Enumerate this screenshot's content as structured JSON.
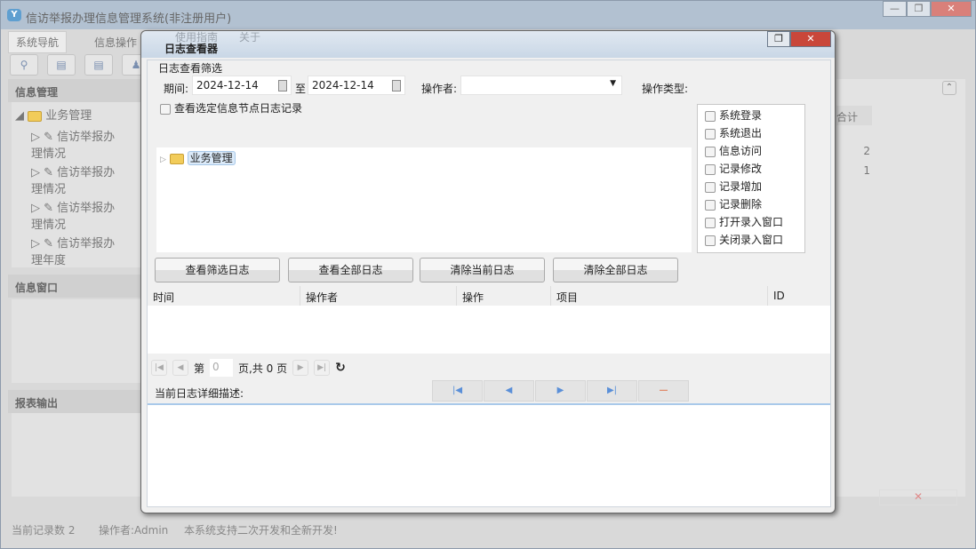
{
  "app": {
    "title": "信访举报办理信息管理系统(非注册用户)",
    "logo_text": "Y"
  },
  "window_controls": {
    "minimize": "—",
    "restore": "❐",
    "close": "✕"
  },
  "tabs": [
    "系统导航",
    "信息操作",
    "使用指南",
    "关于"
  ],
  "toolbar_icons": [
    "search-icon",
    "list-icon",
    "document-icon",
    "user-icon"
  ],
  "sidebar": {
    "sections": [
      "信息管理",
      "信息窗口",
      "报表输出"
    ],
    "tree_root": "业务管理",
    "tree_items": [
      "信访举报办理情况",
      "信访举报办理情况",
      "信访举报办理情况",
      "信访举报办理年度"
    ]
  },
  "right_table": {
    "header": "合计",
    "values": [
      "2",
      "1"
    ]
  },
  "status": {
    "records": "当前记录数 2",
    "operator": "操作者:Admin",
    "message": "本系统支持二次开发和全新开发!"
  },
  "dialog": {
    "title": "日志查看器",
    "filter_title": "日志查看筛选",
    "period_label": "期间:",
    "date_from": "2024-12-14",
    "to_label": "至",
    "date_to": "2024-12-14",
    "operator_label": "操作者:",
    "operator_value": "",
    "type_label": "操作类型:",
    "types": [
      "系统登录",
      "系统退出",
      "信息访问",
      "记录修改",
      "记录增加",
      "记录删除",
      "打开录入窗口",
      "关闭录入窗口"
    ],
    "node_checkbox": "查看选定信息节点日志记录",
    "tree_root": "业务管理",
    "buttons": [
      "查看筛选日志",
      "查看全部日志",
      "清除当前日志",
      "清除全部日志"
    ],
    "columns": [
      "时间",
      "操作者",
      "操作",
      "项目",
      "ID"
    ],
    "pager": {
      "page_prefix": "第",
      "page": "0",
      "page_suffix": "页,共 0 页"
    },
    "detail_label": "当前日志详细描述:"
  }
}
